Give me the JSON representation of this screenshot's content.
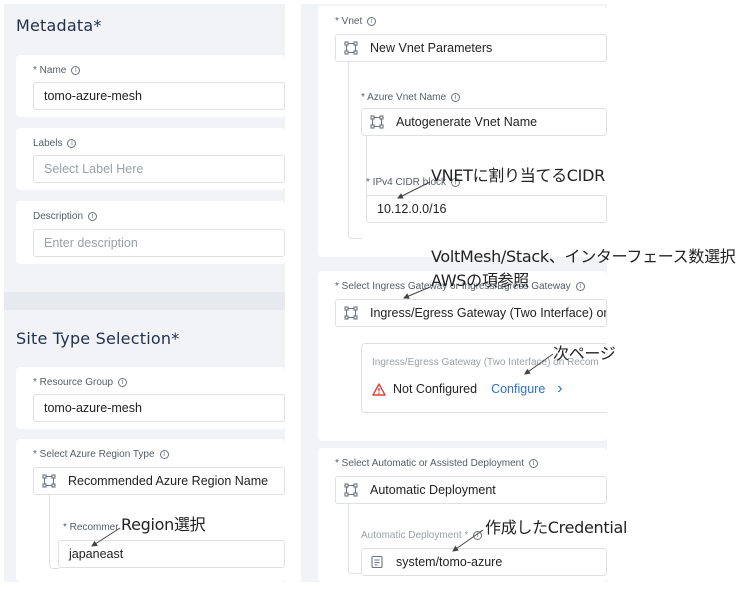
{
  "metadata": {
    "title": "Metadata",
    "required_mark": "*",
    "name": {
      "label": "* Name",
      "value": "tomo-azure-mesh"
    },
    "labels": {
      "label": "Labels",
      "placeholder": "Select Label Here"
    },
    "description": {
      "label": "Description",
      "placeholder": "Enter description"
    }
  },
  "site_type": {
    "title": "Site Type Selection",
    "required_mark": "*",
    "resource_group": {
      "label": "* Resource Group",
      "value": "tomo-azure-mesh"
    },
    "region_type": {
      "label": "* Select Azure Region Type",
      "value": "Recommended Azure Region Name"
    },
    "region": {
      "label": "* Recommer",
      "value": "japaneast"
    }
  },
  "vnet": {
    "label": "* Vnet",
    "value": "New Vnet Parameters",
    "name_label": "* Azure Vnet Name",
    "name_value": "Autogenerate Vnet Name",
    "cidr_label": "* IPv4 CIDR block",
    "cidr_value": "10.12.0.0/16"
  },
  "gateway": {
    "label": "* Select Ingress Gateway or Ingress/Egress Gateway",
    "value": "Ingress/Egress Gateway (Two Interface) on",
    "sub_label": "Ingress/Egress Gateway (Two Interface) on Recom",
    "status": "Not Configured",
    "action": "Configure",
    "chevron": "›"
  },
  "deployment": {
    "label": "* Select Automatic or Assisted Deployment",
    "value": "Automatic Deployment",
    "sub_label": "Automatic Deployment *",
    "sub_value": "system/tomo-azure"
  },
  "annotations": {
    "cidr": "VNETに割り当てるCIDR",
    "gateway_line1": "VoltMesh/Stack、インターフェース数選択",
    "gateway_line2": "AWSの項参照",
    "next_page": "次ページ",
    "region": "Region選択",
    "credential": "作成したCredential"
  },
  "icons": {
    "info": "info-circle-icon",
    "select": "network-nodes-icon",
    "warning": "warning-triangle-icon",
    "credential": "document-icon",
    "chevron": "chevron-right-icon"
  },
  "colors": {
    "panel_bg": "#f1f3f6",
    "title_text": "#23314f",
    "link": "#2c6fd1",
    "warning": "#e0403a"
  }
}
